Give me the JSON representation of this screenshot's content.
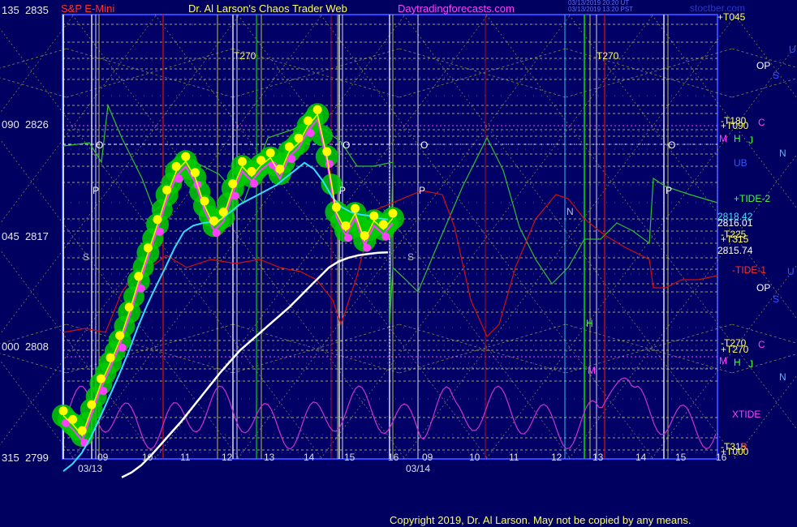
{
  "header": {
    "instrument": "S&P E-Mini",
    "author": "Dr. Al Larson's Chaos Trader Web",
    "site": "Daytradingforecasts.com",
    "stamp_lines": [
      "03/13/2019 20:20 UT",
      "03/13/2019 13:20 PST"
    ],
    "watermark": "stoctber.com"
  },
  "copyright": "Copyright 2019, Dr. Al Larson. May not be copied by any means.",
  "y_labels": [
    {
      "angle": "135",
      "price": "2835"
    },
    {
      "angle": "090",
      "price": "2826"
    },
    {
      "angle": "045",
      "price": "2817"
    },
    {
      "angle": "000",
      "price": "2808"
    },
    {
      "angle": "315",
      "price": "2799"
    }
  ],
  "right_labels": [
    {
      "text": "+T045",
      "color": "#ffff66"
    },
    {
      "text": "U",
      "color": "#3355ff"
    },
    {
      "text": "OP",
      "color": "#ffffff"
    },
    {
      "text": "S",
      "color": "#3355ff"
    },
    {
      "text": "-T180",
      "color": "#ffff66"
    },
    {
      "text": "+T090",
      "color": "#ffff66"
    },
    {
      "text": "C",
      "color": "#ff40ff"
    },
    {
      "text": "M",
      "color": "#ff40ff"
    },
    {
      "text": "H",
      "color": "#40ff40"
    },
    {
      "text": "J",
      "color": "#40ff40"
    },
    {
      "text": "N",
      "color": "#40c0ff"
    },
    {
      "text": "UB",
      "color": "#3355ff"
    },
    {
      "text": "+TIDE-2",
      "color": "#40ff40"
    },
    {
      "text": "2818.42",
      "color": "#40e0ff"
    },
    {
      "text": "2816.01",
      "color": "#ffffff"
    },
    {
      "text": "-T225",
      "color": "#ffff66"
    },
    {
      "text": "+T315",
      "color": "#ffff66"
    },
    {
      "text": "2815.74",
      "color": "#ffffff"
    },
    {
      "text": "-TIDE-1",
      "color": "#ff3030"
    },
    {
      "text": "U",
      "color": "#3355ff"
    },
    {
      "text": "OP",
      "color": "#ffffff"
    },
    {
      "text": "S",
      "color": "#3355ff"
    },
    {
      "text": "-T270",
      "color": "#ffff66"
    },
    {
      "text": "+T270",
      "color": "#ffff66"
    },
    {
      "text": "C",
      "color": "#ff40ff"
    },
    {
      "text": "M",
      "color": "#ff40ff"
    },
    {
      "text": "H",
      "color": "#40ff40"
    },
    {
      "text": "J",
      "color": "#40ff40"
    },
    {
      "text": "N",
      "color": "#40c0ff"
    },
    {
      "text": "XTIDE",
      "color": "#ff40ff"
    },
    {
      "text": "-T315",
      "color": "#ffff66"
    },
    {
      "text": "+T000",
      "color": "#ffff66"
    },
    {
      "text": "R",
      "color": "#ff3030"
    }
  ],
  "in_chart_labels": [
    {
      "text": "T270",
      "color": "#ffff66"
    },
    {
      "text": "T270",
      "color": "#ffff66"
    },
    {
      "text": "O",
      "color": "#ffffff"
    },
    {
      "text": "O",
      "color": "#ffffff"
    },
    {
      "text": "O",
      "color": "#ffffff"
    },
    {
      "text": "O",
      "color": "#ffffff"
    },
    {
      "text": "P",
      "color": "#ffffff"
    },
    {
      "text": "P",
      "color": "#ffffff"
    },
    {
      "text": "P",
      "color": "#ffffff"
    },
    {
      "text": "P",
      "color": "#ffffff"
    },
    {
      "text": "S",
      "color": "#c0c0c0"
    },
    {
      "text": "S",
      "color": "#c0c0c0"
    },
    {
      "text": "N",
      "color": "#c0c0c0"
    },
    {
      "text": "H",
      "color": "#40ff40"
    },
    {
      "text": "M",
      "color": "#ff40ff"
    }
  ],
  "chart_data": {
    "type": "line",
    "title": "S&P E-Mini",
    "xlabel": "",
    "ylabel": "",
    "ylim": [
      2799,
      2835
    ],
    "date_labels": [
      "03/13",
      "03/14"
    ],
    "hour_ticks": {
      "day1": [
        "09",
        "10",
        "11",
        "12",
        "13",
        "14",
        "15",
        "16"
      ],
      "day2": [
        "09",
        "10",
        "11",
        "12",
        "13",
        "14",
        "15",
        "16"
      ]
    },
    "last_values": {
      "cyan_avg": "2818.42",
      "white_avg": "2815.74",
      "price": "2816.01"
    },
    "colors": {
      "price": "#ffff00",
      "band": "#00cc00",
      "pink": "#ff40ff",
      "cyan": "#33ddff",
      "white": "#ffffff",
      "tide_green": "#30c030",
      "tide_red": "#d01010",
      "xtide": "#cc33cc",
      "grid": "#dddd44",
      "frame": "#3344ff"
    },
    "series": [
      {
        "values": [
          2802.5,
          2801.8,
          2800.9,
          2803.0,
          2805.1,
          2806.8,
          2808.6,
          2810.9,
          2813.4,
          2815.7,
          2818.0,
          2820.4,
          2822.3,
          2823.1,
          2821.8,
          2819.5,
          2817.9,
          2818.6,
          2820.9,
          2822.7,
          2821.9,
          2822.8,
          2823.4,
          2822.1,
          2823.9,
          2824.6,
          2826.0,
          2826.9,
          2823.5,
          2819.0,
          2817.5,
          2818.9,
          2816.7,
          2818.3,
          2817.6,
          2818.5
        ]
      },
      {
        "values": [
          2798.0,
          2798.6,
          2799.5,
          2800.8,
          2802.4,
          2804.1,
          2805.8,
          2807.6,
          2809.6,
          2811.4,
          2813.0,
          2814.5,
          2816.1,
          2817.4,
          2817.9,
          2818.1,
          2818.2,
          2818.4,
          2819.0,
          2819.6,
          2820.0,
          2820.4,
          2820.8,
          2821.2,
          2821.8,
          2822.4,
          2823.0,
          2822.5,
          2821.5,
          2820.2,
          2819.4,
          2819.0,
          2818.8,
          2818.7,
          2818.5,
          2818.4
        ]
      },
      {
        "values": [
          2797.5,
          2797.9,
          2798.5,
          2799.3,
          2800.2,
          2801.1,
          2802.0,
          2803.0,
          2804.0,
          2805.0,
          2806.0,
          2806.9,
          2807.8,
          2808.5,
          2809.2,
          2809.9,
          2810.6,
          2811.3,
          2812.1,
          2812.9,
          2813.7,
          2814.5,
          2815.0,
          2815.3,
          2815.5,
          2815.6,
          2815.7,
          2815.74
        ]
      }
    ]
  }
}
